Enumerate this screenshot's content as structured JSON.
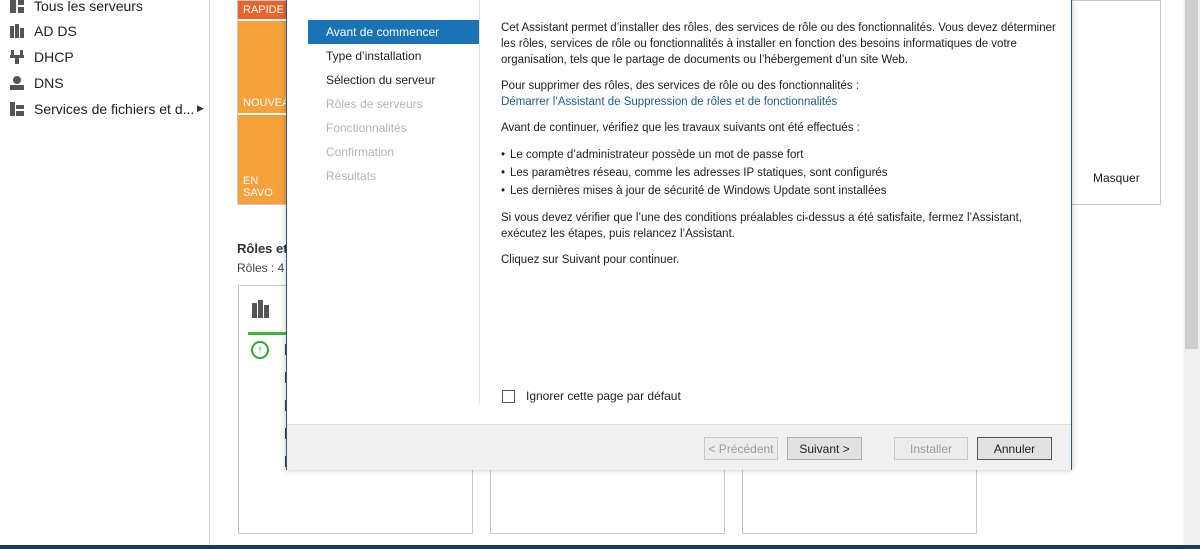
{
  "nav": {
    "items": [
      {
        "label": "Tous les serveurs",
        "icon": "servers-icon"
      },
      {
        "label": "AD DS",
        "icon": "ad-ds-icon"
      },
      {
        "label": "DHCP",
        "icon": "dhcp-icon"
      },
      {
        "label": "DNS",
        "icon": "dns-icon"
      },
      {
        "label": "Services de fichiers et d...",
        "icon": "file-services-icon"
      }
    ]
  },
  "dashboard": {
    "tile_segments": [
      "RAPIDE",
      "NOUVEA",
      "EN SAVO"
    ],
    "hide_label": "Masquer",
    "roles_title": "Rôles et",
    "roles_count": "Rôles : 4"
  },
  "wizard": {
    "steps": [
      {
        "label": "Avant de commencer",
        "state": "active"
      },
      {
        "label": "Type d’installation",
        "state": "enabled"
      },
      {
        "label": "Sélection du serveur",
        "state": "enabled"
      },
      {
        "label": "Rôles de serveurs",
        "state": "disabled"
      },
      {
        "label": "Fonctionnalités",
        "state": "disabled"
      },
      {
        "label": "Confirmation",
        "state": "disabled"
      },
      {
        "label": "Résultats",
        "state": "disabled"
      }
    ],
    "intro": "Cet Assistant permet d’installer des rôles, des services de rôle ou des fonctionnalités. Vous devez déterminer les rôles, services de rôle ou fonctionnalités à installer en fonction des besoins informatiques de votre organisation, tels que le partage de documents ou l’hébergement d’un site Web.",
    "remove_text": "Pour supprimer des rôles, des services de rôle ou des fonctionnalités :",
    "remove_link": "Démarrer l’Assistant de Suppression de rôles et de fonctionnalités",
    "before_text": "Avant de continuer, vérifiez que les travaux suivants ont été effectués :",
    "prerequisites": [
      "Le compte d’administrateur possède un mot de passe fort",
      "Les paramètres réseau, comme les adresses IP statiques, sont configurés",
      "Les dernières mises à jour de sécurité de Windows Update sont installées"
    ],
    "verify_text": "Si vous devez vérifier que l’une des conditions préalables ci-dessus a été satisfaite, fermez l’Assistant, exécutez les étapes, puis relancez l’Assistant.",
    "next_text": "Cliquez sur Suivant pour continuer.",
    "skip_checkbox_label": "Ignorer cette page par défaut",
    "skip_checked": false,
    "buttons": {
      "previous": "< Précédent",
      "next": "Suivant >",
      "install": "Installer",
      "cancel": "Annuler"
    }
  },
  "colors": {
    "accent": "#1a73b5",
    "link": "#1a5e8c",
    "tile_orange": "#f7a13d",
    "tile_red": "#e8642a",
    "status_green": "#3db83d"
  }
}
